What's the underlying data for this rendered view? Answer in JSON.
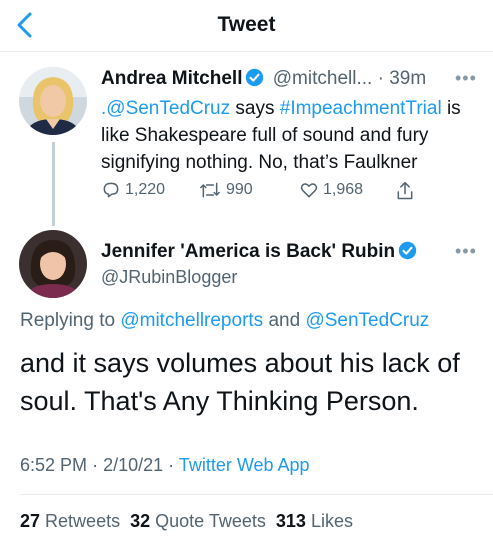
{
  "header": {
    "title": "Tweet"
  },
  "parent_tweet": {
    "author_name": "Andrea Mitchell",
    "handle": "@mitchell...",
    "separator": "·",
    "time": "39m",
    "text": {
      "mention": ".@SenTedCruz",
      "part1": " says ",
      "hashtag": "#ImpeachmentTrial",
      "part2": " is like Shakespeare full of sound and fury signifying nothing. No, that’s Faulkner"
    },
    "reply_count": "1,220",
    "retweet_count": "990",
    "like_count": "1,968"
  },
  "main_tweet": {
    "author_name": "Jennifer 'America is Back' Rubin",
    "handle": "@JRubinBlogger",
    "replying_label": "Replying to",
    "reply_to_1": "@mitchellreports",
    "reply_and": "and",
    "reply_to_2": "@SenTedCruz",
    "text": "and it says volumes about his lack of soul. That's Any Thinking Person.",
    "time": "6:52 PM",
    "sep": "·",
    "date": "2/10/21",
    "sep2": "·",
    "source": "Twitter Web App",
    "retweets": "27",
    "retweets_label": "Retweets",
    "quotes": "32",
    "quotes_label": "Quote Tweets",
    "likes": "313",
    "likes_label": "Likes"
  },
  "colors": {
    "accent": "#1d9bf0",
    "muted": "#536471",
    "text": "#0f1419"
  },
  "icons": [
    "back-arrow-icon",
    "verified-icon",
    "more-icon",
    "reply-icon",
    "retweet-icon",
    "like-icon",
    "share-icon"
  ]
}
